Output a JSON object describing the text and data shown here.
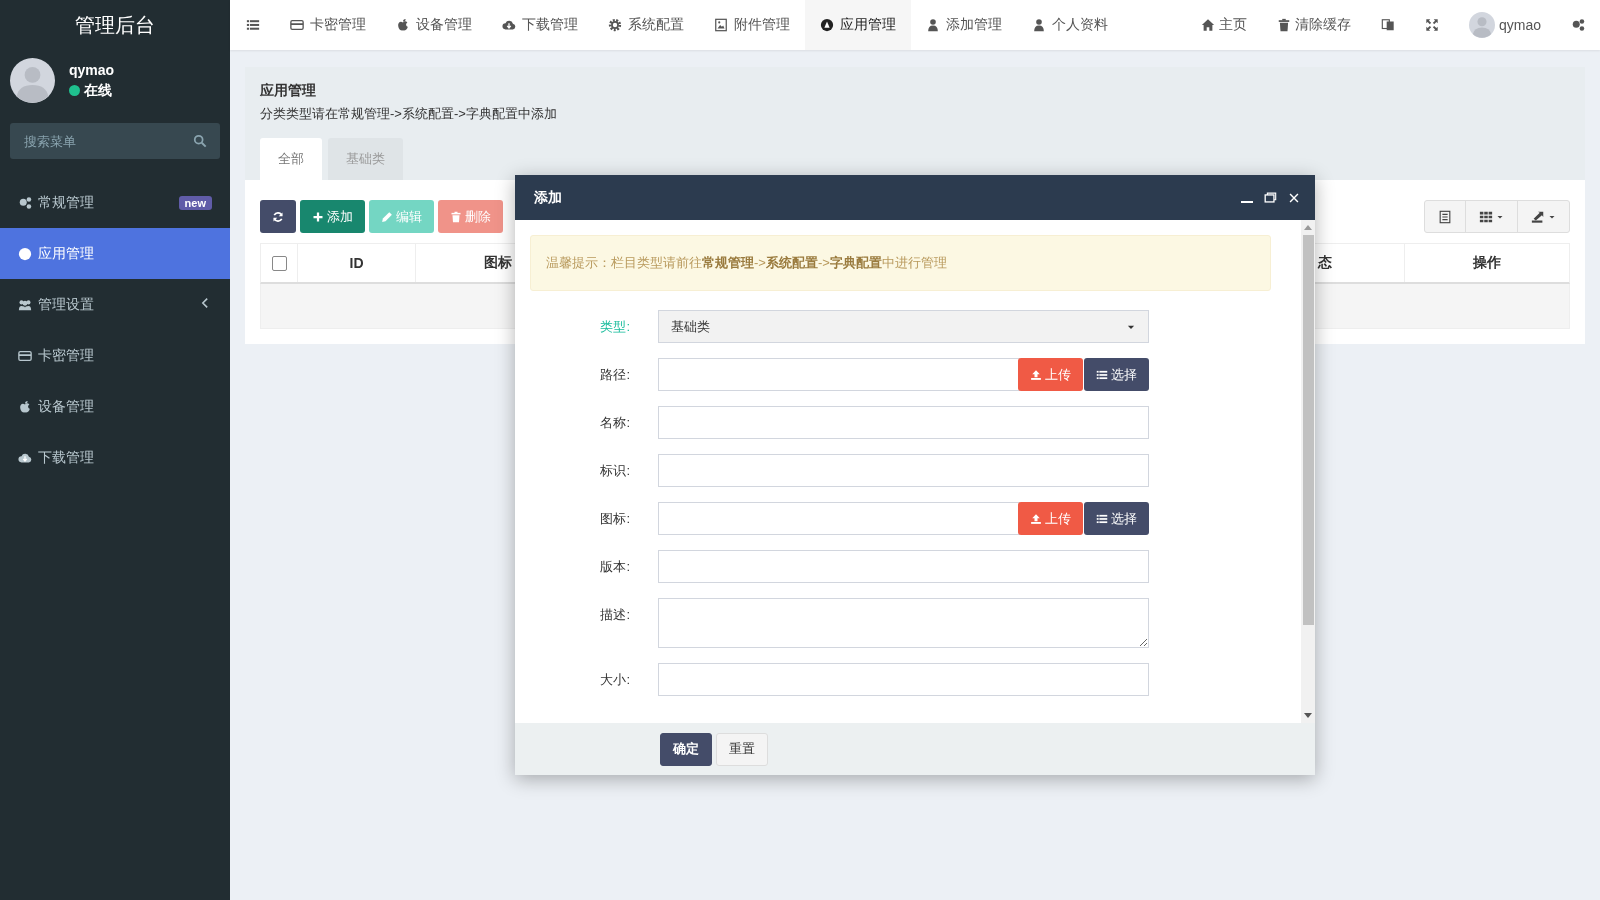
{
  "sidebar": {
    "title": "管理后台",
    "user": {
      "name": "qymao",
      "status": "在线",
      "online": true
    },
    "search": {
      "placeholder": "搜索菜单"
    },
    "items": [
      {
        "label": "常规管理",
        "badge": "new",
        "selected": false
      },
      {
        "label": "应用管理",
        "selected": true
      },
      {
        "label": "管理设置",
        "selected": false,
        "expanded": false
      },
      {
        "label": "卡密管理",
        "selected": false
      },
      {
        "label": "设备管理",
        "selected": false
      },
      {
        "label": "下载管理",
        "selected": false
      }
    ]
  },
  "topbar": {
    "nav": [
      {
        "label": "卡密管理",
        "selected": false
      },
      {
        "label": "设备管理",
        "selected": false
      },
      {
        "label": "下载管理",
        "selected": false
      },
      {
        "label": "系统配置",
        "selected": false
      },
      {
        "label": "附件管理",
        "selected": false
      },
      {
        "label": "应用管理",
        "selected": true
      },
      {
        "label": "添加管理",
        "selected": false
      },
      {
        "label": "个人资料",
        "selected": false
      }
    ],
    "links": [
      {
        "label": "主页"
      },
      {
        "label": "清除缓存"
      }
    ],
    "user": "qymao"
  },
  "page": {
    "title": "应用管理",
    "description": "分类类型请在常规管理->系统配置->字典配置中添加",
    "tabs": [
      {
        "label": "全部",
        "selected": true
      },
      {
        "label": "基础类",
        "selected": false
      }
    ],
    "toolbar": [
      {
        "kind": "refresh",
        "disabled": false
      },
      {
        "kind": "add",
        "label": "添加",
        "disabled": false
      },
      {
        "kind": "edit",
        "label": "编辑",
        "disabled": true
      },
      {
        "kind": "delete",
        "label": "删除",
        "disabled": true
      }
    ],
    "table": {
      "select_all": {
        "checked": false
      },
      "columns": [
        "ID",
        "图标",
        "态",
        "操作"
      ]
    }
  },
  "dialog": {
    "title": "添加",
    "notice": "温馨提示：栏目类型请前往**常规管理**->**系统配置**->**字典配置**中进行管理",
    "fields": [
      {
        "kind": "select",
        "label": "类型:",
        "value": "基础类",
        "active": true
      },
      {
        "kind": "upload",
        "label": "路径:",
        "upload": "上传",
        "choose": "选择",
        "active": false
      },
      {
        "kind": "text",
        "label": "名称:",
        "active": false
      },
      {
        "kind": "text",
        "label": "标识:",
        "active": false
      },
      {
        "kind": "upload",
        "label": "图标:",
        "upload": "上传",
        "choose": "选择",
        "active": false
      },
      {
        "kind": "text",
        "label": "版本:",
        "active": false
      },
      {
        "kind": "textarea",
        "label": "描述:",
        "active": false
      },
      {
        "kind": "text",
        "label": "大小:",
        "active": false
      }
    ],
    "buttons": [
      {
        "label": "确定",
        "primary": true
      },
      {
        "label": "重置",
        "primary": false
      }
    ]
  }
}
